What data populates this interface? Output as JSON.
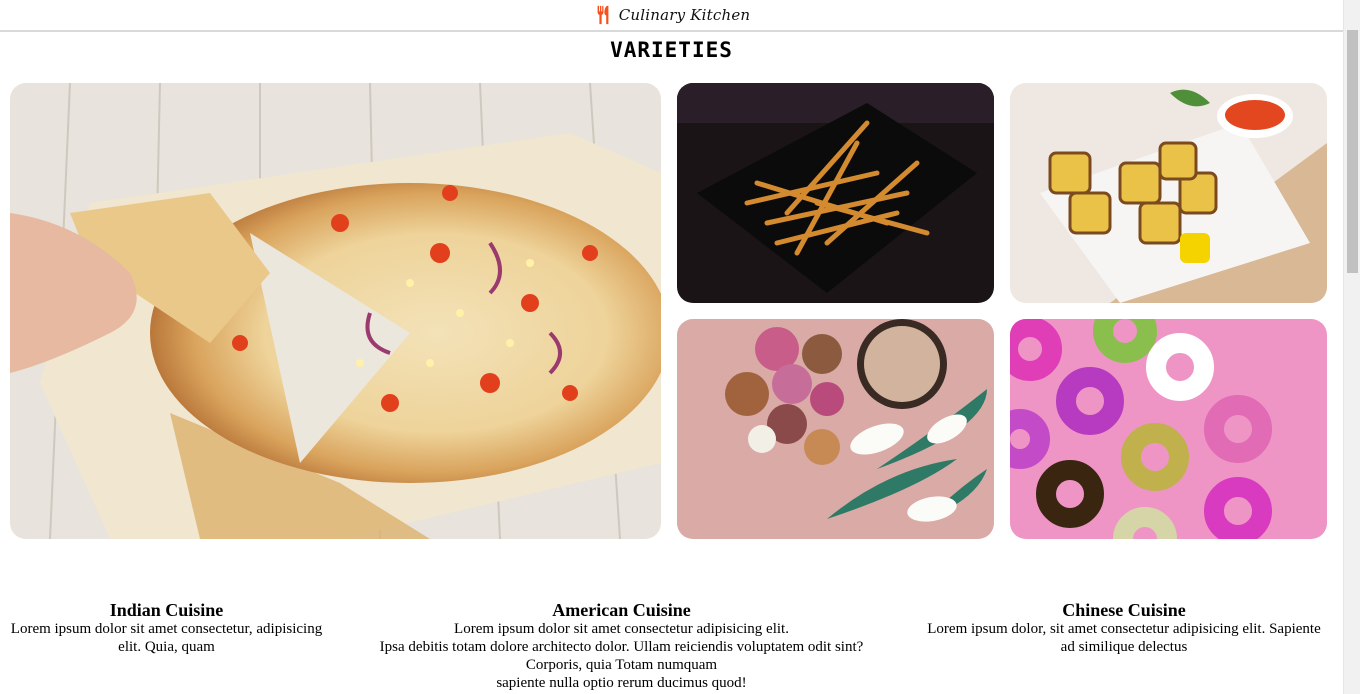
{
  "header": {
    "brand_name": "Culinary Kitchen",
    "brand_icon": "utensils-icon",
    "accent": "#f4511e"
  },
  "section": {
    "title": "VARIETIES"
  },
  "gallery": [
    {
      "subject": "pizza-image"
    },
    {
      "subject": "fries-image"
    },
    {
      "subject": "paneer-skewers-image"
    },
    {
      "subject": "macarons-image"
    },
    {
      "subject": "donuts-image"
    }
  ],
  "cuisines": [
    {
      "title": "Indian Cuisine",
      "lines": [
        "Lorem ipsum dolor sit amet consectetur, adipisicing",
        "elit. Quia, quam"
      ]
    },
    {
      "title": "American Cuisine",
      "lines": [
        "Lorem ipsum dolor sit amet consectetur adipisicing elit.",
        "Ipsa debitis totam dolore architecto dolor. Ullam reiciendis voluptatem odit sint?",
        "Corporis, quia Totam numquam",
        "sapiente nulla optio rerum ducimus quod!"
      ]
    },
    {
      "title": "Chinese Cuisine",
      "lines": [
        "Lorem ipsum dolor, sit amet consectetur adipisicing elit. Sapiente",
        "ad similique delectus"
      ]
    }
  ]
}
